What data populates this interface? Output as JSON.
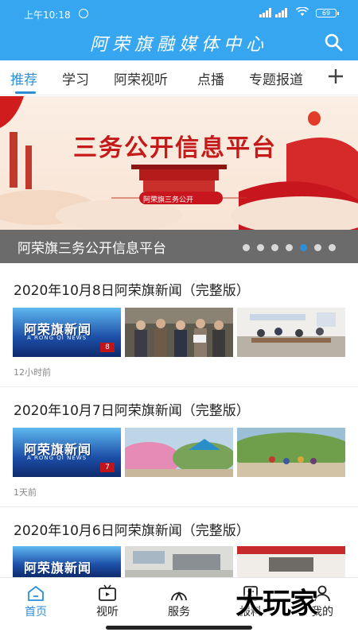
{
  "status_bar": {
    "time": "上午10:18",
    "battery": "69"
  },
  "header": {
    "title": "阿荣旗融媒体中心"
  },
  "tabs": [
    {
      "label": "推荐"
    },
    {
      "label": "学习"
    },
    {
      "label": "阿荣视听"
    },
    {
      "label": "点播"
    },
    {
      "label": "专题报道"
    }
  ],
  "banner": {
    "headline": "三务公开信息平台",
    "ribbon_text": "阿荣旗三务公开",
    "caption": "阿荣旗三务公开信息平台",
    "dot_count": 7,
    "active_dot": 4
  },
  "news": [
    {
      "title": "2020年10月8日阿荣旗新闻（完整版）",
      "time": "12小时前",
      "episode": "8",
      "logo": "阿荣旗新闻",
      "logo_sub": "A RONG QI NEWS"
    },
    {
      "title": "2020年10月7日阿荣旗新闻（完整版）",
      "time": "1天前",
      "episode": "7",
      "logo": "阿荣旗新闻",
      "logo_sub": "A RONG QI NEWS"
    },
    {
      "title": "2020年10月6日阿荣旗新闻（完整版）",
      "time": "",
      "episode": "",
      "logo": "阿荣旗新闻",
      "logo_sub": ""
    }
  ],
  "bottom_nav": [
    {
      "label": "首页",
      "icon": "home-icon"
    },
    {
      "label": "视听",
      "icon": "tv-icon"
    },
    {
      "label": "服务",
      "icon": "service-icon"
    },
    {
      "label": "报料",
      "icon": "report-icon"
    },
    {
      "label": "我的",
      "icon": "user-icon"
    }
  ],
  "watermark": "大玩家",
  "colors": {
    "brand": "#35a6ef",
    "accent": "#2b8fd8"
  }
}
